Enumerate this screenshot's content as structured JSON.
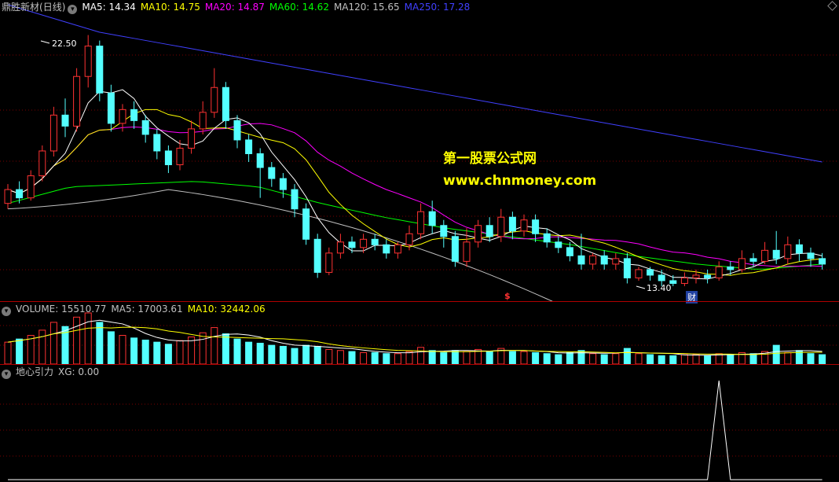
{
  "main": {
    "stock_name": "鼎胜新材",
    "period": "(日线)",
    "ma_items": [
      {
        "label": "MA5: 14.34",
        "color": "#ffffff"
      },
      {
        "label": "MA10: 14.75",
        "color": "#ffff00"
      },
      {
        "label": "MA20: 14.87",
        "color": "#ff00ff"
      },
      {
        "label": "MA60: 14.62",
        "color": "#00ff00"
      },
      {
        "label": "MA120: 15.65",
        "color": "#c0c0c0"
      },
      {
        "label": "MA250: 17.28",
        "color": "#4040ff"
      }
    ],
    "high_label": "22.50",
    "low_label": "13.40",
    "marker_dollar": "$",
    "marker_cai": "财",
    "watermark_title": "第一股票公式网",
    "watermark_url": "www.chnmoney.com"
  },
  "volume": {
    "items": [
      {
        "label": "VOLUME: 15510.77",
        "color": "#c0c0c0"
      },
      {
        "label": "MA5: 17003.61",
        "color": "#c0c0c0"
      },
      {
        "label": "MA10: 32442.06",
        "color": "#ffff00"
      }
    ]
  },
  "indicator": {
    "name": "地心引力",
    "value_label": "XG: 0.00"
  },
  "colors": {
    "up": "#ff3232",
    "down": "#54ffff",
    "ma5": "#ffffff",
    "ma10": "#ffff00",
    "ma20": "#ff00ff",
    "ma60": "#00ff00",
    "ma120": "#c0c0c0",
    "ma250": "#4040ff"
  },
  "chart_data": {
    "type": "candlestick",
    "y_range": [
      13.0,
      23.2
    ],
    "points": [
      {
        "o": 16.4,
        "c": 16.9,
        "h": 17.1,
        "l": 16.2
      },
      {
        "o": 16.9,
        "c": 16.6,
        "h": 17.2,
        "l": 16.4
      },
      {
        "o": 16.6,
        "c": 17.4,
        "h": 17.6,
        "l": 16.5
      },
      {
        "o": 17.4,
        "c": 18.3,
        "h": 18.5,
        "l": 17.2
      },
      {
        "o": 18.3,
        "c": 19.6,
        "h": 19.9,
        "l": 18.1
      },
      {
        "o": 19.6,
        "c": 19.2,
        "h": 20.2,
        "l": 18.8
      },
      {
        "o": 19.2,
        "c": 21.0,
        "h": 21.3,
        "l": 19.0
      },
      {
        "o": 21.0,
        "c": 22.1,
        "h": 22.5,
        "l": 20.6
      },
      {
        "o": 22.1,
        "c": 20.4,
        "h": 22.3,
        "l": 20.1
      },
      {
        "o": 20.4,
        "c": 19.3,
        "h": 20.7,
        "l": 19.0
      },
      {
        "o": 19.3,
        "c": 19.8,
        "h": 20.0,
        "l": 19.0
      },
      {
        "o": 19.8,
        "c": 19.4,
        "h": 20.1,
        "l": 19.1
      },
      {
        "o": 19.4,
        "c": 18.9,
        "h": 19.6,
        "l": 18.6
      },
      {
        "o": 18.9,
        "c": 18.3,
        "h": 19.1,
        "l": 18.0
      },
      {
        "o": 18.3,
        "c": 17.8,
        "h": 18.5,
        "l": 17.5
      },
      {
        "o": 17.8,
        "c": 18.4,
        "h": 18.7,
        "l": 17.6
      },
      {
        "o": 18.4,
        "c": 19.1,
        "h": 19.4,
        "l": 18.2
      },
      {
        "o": 19.1,
        "c": 19.7,
        "h": 20.1,
        "l": 18.9
      },
      {
        "o": 19.7,
        "c": 20.6,
        "h": 21.3,
        "l": 19.5
      },
      {
        "o": 20.6,
        "c": 19.4,
        "h": 20.8,
        "l": 19.1
      },
      {
        "o": 19.4,
        "c": 18.7,
        "h": 19.6,
        "l": 18.4
      },
      {
        "o": 18.7,
        "c": 18.2,
        "h": 18.9,
        "l": 17.9
      },
      {
        "o": 18.2,
        "c": 17.7,
        "h": 18.4,
        "l": 16.6
      },
      {
        "o": 17.7,
        "c": 17.3,
        "h": 17.9,
        "l": 17.0
      },
      {
        "o": 17.3,
        "c": 16.9,
        "h": 17.5,
        "l": 16.6
      },
      {
        "o": 16.9,
        "c": 16.2,
        "h": 17.1,
        "l": 15.9
      },
      {
        "o": 16.2,
        "c": 15.1,
        "h": 16.4,
        "l": 14.9
      },
      {
        "o": 15.1,
        "c": 13.9,
        "h": 15.3,
        "l": 13.7
      },
      {
        "o": 13.9,
        "c": 14.6,
        "h": 14.8,
        "l": 13.8
      },
      {
        "o": 14.6,
        "c": 15.0,
        "h": 15.3,
        "l": 14.4
      },
      {
        "o": 15.0,
        "c": 14.8,
        "h": 15.2,
        "l": 14.6
      },
      {
        "o": 14.8,
        "c": 15.1,
        "h": 15.3,
        "l": 14.6
      },
      {
        "o": 15.1,
        "c": 14.9,
        "h": 15.3,
        "l": 14.7
      },
      {
        "o": 14.9,
        "c": 14.6,
        "h": 15.1,
        "l": 14.4
      },
      {
        "o": 14.6,
        "c": 14.9,
        "h": 15.0,
        "l": 14.4
      },
      {
        "o": 14.9,
        "c": 15.3,
        "h": 15.6,
        "l": 14.7
      },
      {
        "o": 15.3,
        "c": 16.1,
        "h": 16.4,
        "l": 15.1
      },
      {
        "o": 16.1,
        "c": 15.6,
        "h": 16.5,
        "l": 15.3
      },
      {
        "o": 15.6,
        "c": 15.2,
        "h": 15.8,
        "l": 14.8
      },
      {
        "o": 15.2,
        "c": 14.3,
        "h": 15.4,
        "l": 14.1
      },
      {
        "o": 14.3,
        "c": 15.0,
        "h": 15.5,
        "l": 14.1
      },
      {
        "o": 15.0,
        "c": 15.6,
        "h": 15.8,
        "l": 14.8
      },
      {
        "o": 15.6,
        "c": 15.2,
        "h": 15.9,
        "l": 15.0
      },
      {
        "o": 15.2,
        "c": 15.9,
        "h": 16.2,
        "l": 15.0
      },
      {
        "o": 15.9,
        "c": 15.4,
        "h": 16.1,
        "l": 15.1
      },
      {
        "o": 15.4,
        "c": 15.8,
        "h": 16.0,
        "l": 15.2
      },
      {
        "o": 15.8,
        "c": 15.3,
        "h": 16.0,
        "l": 15.0
      },
      {
        "o": 15.3,
        "c": 15.0,
        "h": 15.5,
        "l": 14.8
      },
      {
        "o": 15.0,
        "c": 14.8,
        "h": 15.2,
        "l": 14.6
      },
      {
        "o": 14.8,
        "c": 14.5,
        "h": 15.0,
        "l": 14.3
      },
      {
        "o": 14.5,
        "c": 14.2,
        "h": 15.3,
        "l": 14.0
      },
      {
        "o": 14.2,
        "c": 14.5,
        "h": 14.6,
        "l": 14.0
      },
      {
        "o": 14.5,
        "c": 14.2,
        "h": 14.7,
        "l": 14.0
      },
      {
        "o": 14.2,
        "c": 14.4,
        "h": 14.6,
        "l": 14.0
      },
      {
        "o": 14.4,
        "c": 13.7,
        "h": 14.6,
        "l": 13.5
      },
      {
        "o": 13.7,
        "c": 14.0,
        "h": 14.1,
        "l": 13.6
      },
      {
        "o": 14.0,
        "c": 13.8,
        "h": 14.1,
        "l": 13.6
      },
      {
        "o": 13.8,
        "c": 13.6,
        "h": 14.0,
        "l": 13.4
      },
      {
        "o": 13.6,
        "c": 13.5,
        "h": 13.8,
        "l": 13.4
      },
      {
        "o": 13.5,
        "c": 13.7,
        "h": 13.9,
        "l": 13.4
      },
      {
        "o": 13.7,
        "c": 13.8,
        "h": 14.0,
        "l": 13.5
      },
      {
        "o": 13.8,
        "c": 13.7,
        "h": 14.0,
        "l": 13.5
      },
      {
        "o": 13.7,
        "c": 14.1,
        "h": 14.3,
        "l": 13.6
      },
      {
        "o": 14.1,
        "c": 14.0,
        "h": 14.3,
        "l": 13.8
      },
      {
        "o": 14.0,
        "c": 14.4,
        "h": 14.7,
        "l": 13.9
      },
      {
        "o": 14.4,
        "c": 14.3,
        "h": 14.6,
        "l": 14.1
      },
      {
        "o": 14.3,
        "c": 14.7,
        "h": 15.0,
        "l": 14.2
      },
      {
        "o": 14.7,
        "c": 14.4,
        "h": 15.4,
        "l": 14.2
      },
      {
        "o": 14.4,
        "c": 14.9,
        "h": 15.2,
        "l": 14.2
      },
      {
        "o": 14.9,
        "c": 14.6,
        "h": 15.1,
        "l": 14.3
      },
      {
        "o": 14.6,
        "c": 14.4,
        "h": 14.8,
        "l": 14.1
      },
      {
        "o": 14.4,
        "c": 14.2,
        "h": 14.6,
        "l": 14.0
      }
    ],
    "volume": [
      42,
      48,
      55,
      65,
      80,
      72,
      90,
      98,
      80,
      62,
      55,
      50,
      46,
      42,
      38,
      45,
      52,
      60,
      70,
      58,
      48,
      42,
      40,
      36,
      34,
      30,
      36,
      34,
      28,
      26,
      24,
      22,
      22,
      20,
      20,
      24,
      32,
      26,
      22,
      26,
      24,
      28,
      24,
      30,
      24,
      24,
      22,
      20,
      18,
      22,
      26,
      20,
      18,
      20,
      30,
      20,
      18,
      16,
      16,
      18,
      18,
      16,
      20,
      18,
      22,
      20,
      24,
      36,
      22,
      26,
      20,
      18
    ],
    "indicator_xg": [
      0,
      0,
      0,
      0,
      0,
      0,
      0,
      0,
      0,
      0,
      0,
      0,
      0,
      0,
      0,
      0,
      0,
      0,
      0,
      0,
      0,
      0,
      0,
      0,
      0,
      0,
      0,
      0,
      0,
      0,
      0,
      0,
      0,
      0,
      0,
      0,
      0,
      0,
      0,
      0,
      0,
      0,
      0,
      0,
      0,
      0,
      0,
      0,
      0,
      0,
      0,
      0,
      0,
      0,
      0,
      0,
      0,
      0,
      0,
      0,
      0,
      0,
      1,
      0,
      0,
      0,
      0,
      0,
      0,
      0,
      0,
      0
    ]
  }
}
